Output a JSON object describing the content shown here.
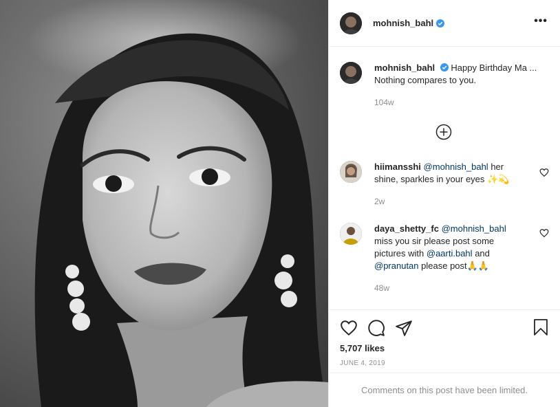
{
  "post": {
    "username": "mohnish_bahl",
    "more_label": "•••"
  },
  "caption": {
    "username": "mohnish_bahl",
    "text": "Happy Birthday Ma ... Nothing compares to you.",
    "time": "104w"
  },
  "comments": [
    {
      "username": "hiimansshi",
      "mention": "@mohnish_bahl",
      "text": "her shine, sparkles in your eyes ✨💫",
      "time": "2w"
    },
    {
      "username": "daya_shetty_fc",
      "mention": "@mohnish_bahl",
      "text_1": "miss you sir please post some pictures with",
      "mention_2": "@aarti.bahl",
      "text_2": "and",
      "mention_3": "@pranutan",
      "text_3": "please post🙏🙏",
      "time": "48w"
    }
  ],
  "actions": {
    "likes": "5,707 likes",
    "date": "JUNE 4, 2019"
  },
  "footer": {
    "limited_text": "Comments on this post have been limited."
  },
  "colors": {
    "verified": "#3897f0",
    "mention": "#00376b",
    "muted": "#8e8e8e"
  },
  "icons": [
    "verified-badge-icon",
    "more-options-icon",
    "load-more-comments-icon",
    "heart-icon",
    "comment-icon",
    "share-icon",
    "save-icon"
  ]
}
